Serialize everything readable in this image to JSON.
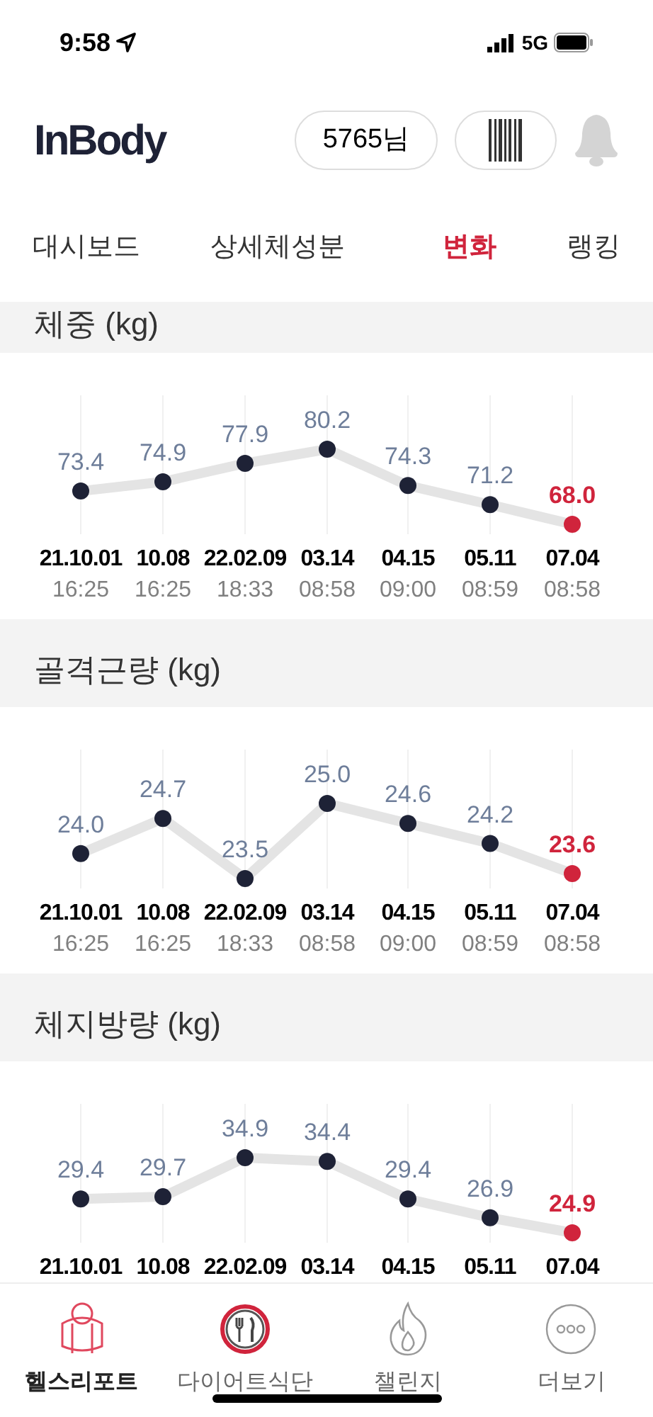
{
  "status_bar": {
    "time": "9:58",
    "network": "5G"
  },
  "header": {
    "logo": "InBody",
    "user_button": "5765님"
  },
  "tabs": [
    {
      "label": "대시보드",
      "selected": false
    },
    {
      "label": "상세체성분",
      "selected": false
    },
    {
      "label": "변화",
      "selected": true
    },
    {
      "label": "랭킹",
      "selected": false
    }
  ],
  "sections": [
    {
      "title": "체중 (kg)",
      "times": [
        "16:25",
        "16:25",
        "18:33",
        "08:58",
        "09:00",
        "08:59",
        "08:58"
      ],
      "chart_data": {
        "type": "line",
        "categories": [
          "21.10.01",
          "10.08",
          "22.02.09",
          "03.14",
          "04.15",
          "05.11",
          "07.04"
        ],
        "grid": true,
        "data_labels": true,
        "series": [
          {
            "marker": "circle",
            "values": [
              73.4,
              74.9,
              77.9,
              80.2,
              74.3,
              71.2,
              68.0
            ],
            "value_labels": [
              "73.4",
              "74.9",
              "77.9",
              "80.2",
              "74.3",
              "71.2",
              "68.0"
            ]
          }
        ]
      }
    },
    {
      "title": "골격근량 (kg)",
      "times": [
        "16:25",
        "16:25",
        "18:33",
        "08:58",
        "09:00",
        "08:59",
        "08:58"
      ],
      "chart_data": {
        "type": "line",
        "categories": [
          "21.10.01",
          "10.08",
          "22.02.09",
          "03.14",
          "04.15",
          "05.11",
          "07.04"
        ],
        "grid": true,
        "data_labels": true,
        "series": [
          {
            "marker": "circle",
            "values": [
              24.0,
              24.7,
              23.5,
              25.0,
              24.6,
              24.2,
              23.6
            ],
            "value_labels": [
              "24.0",
              "24.7",
              "23.5",
              "25.0",
              "24.6",
              "24.2",
              "23.6"
            ]
          }
        ]
      }
    },
    {
      "title": "체지방량 (kg)",
      "chart_data": {
        "type": "line",
        "categories": [
          "21.10.01",
          "10.08",
          "22.02.09",
          "03.14",
          "04.15",
          "05.11",
          "07.04"
        ],
        "grid": true,
        "data_labels": true,
        "series": [
          {
            "marker": "circle",
            "values": [
              29.4,
              29.7,
              34.9,
              34.4,
              29.4,
              26.9,
              24.9
            ],
            "value_labels": [
              "29.4",
              "29.7",
              "34.9",
              "34.4",
              "29.4",
              "26.9",
              "24.9"
            ]
          }
        ]
      }
    }
  ],
  "bottom_nav": [
    {
      "label": "헬스리포트",
      "kind": "report",
      "selected": true
    },
    {
      "label": "다이어트식단",
      "kind": "diet",
      "selected": false
    },
    {
      "label": "챌린지",
      "kind": "challenge",
      "selected": false
    },
    {
      "label": "더보기",
      "kind": "more",
      "selected": false
    }
  ]
}
